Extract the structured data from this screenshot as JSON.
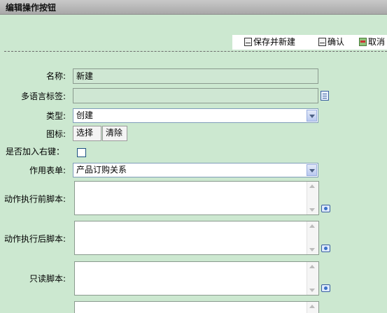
{
  "title": "编辑操作按钮",
  "toolbar": {
    "save_new": "保存并新建",
    "confirm": "确认",
    "cancel": "取消"
  },
  "form": {
    "name_label": "名称:",
    "name_value": "新建",
    "lang_label": "多语言标签:",
    "lang_value": "",
    "type_label": "类型:",
    "type_value": "创建",
    "icon_label": "图标:",
    "icon_select": "选择",
    "icon_clear": "清除",
    "context_label": "是否加入右键：",
    "context_checked": false,
    "form_label": "作用表单:",
    "form_value": "产品订购关系",
    "pre_script_label": "动作执行前脚本:",
    "post_script_label": "动作执行后脚本:",
    "readonly_script_label": "只读脚本:"
  },
  "icons": {
    "save": "save-icon",
    "confirm": "confirm-icon",
    "cancel": "cancel-icon",
    "edit": "script-edit-icon",
    "lang": "lang-edit-icon"
  }
}
